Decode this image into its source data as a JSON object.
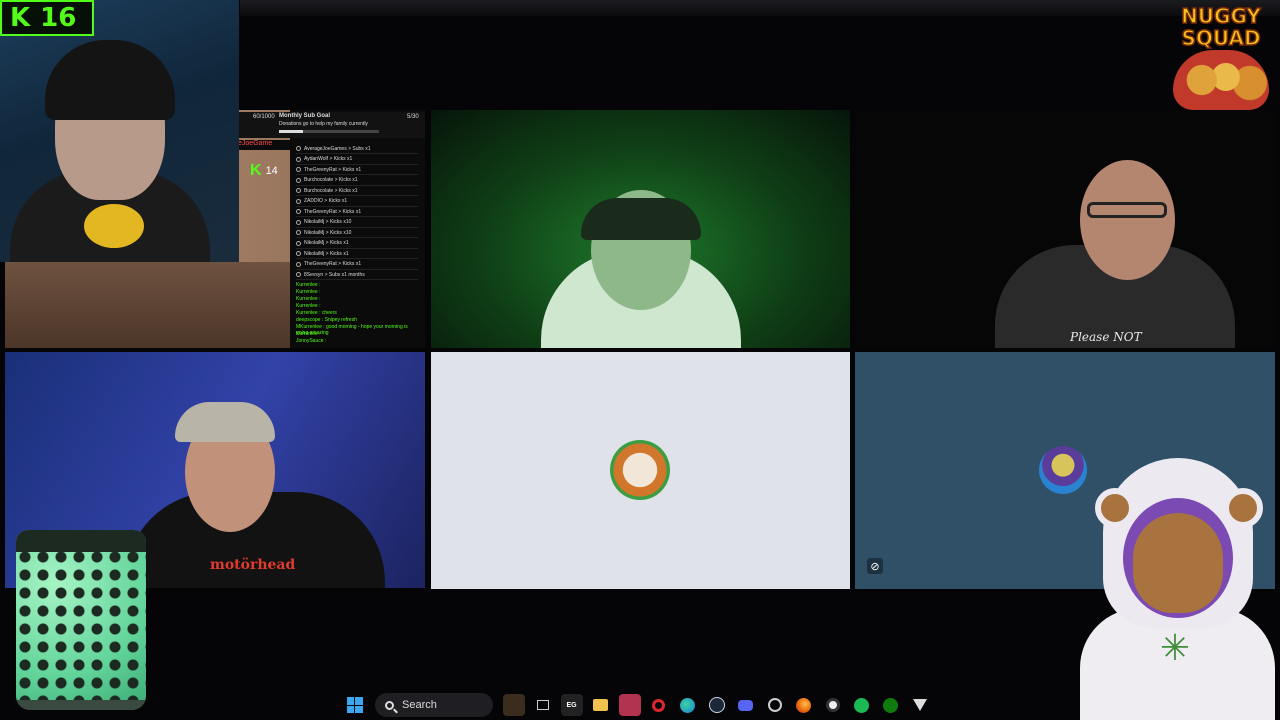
{
  "overlay": {
    "kick_viewers": "16",
    "kick_letter": "K"
  },
  "participants": [
    {
      "kick_letter": "K",
      "kick_viewers": "14",
      "name_partial": "eJoeGame"
    },
    {},
    {
      "shirt_text": "Please NOT"
    },
    {
      "band_shirt_text": "motörhead"
    },
    {},
    {}
  ],
  "sub_goal": {
    "title": "Monthly Sub Goal",
    "subtitle": "Donations go to help my family currently",
    "count": "60/1000",
    "right_count": "5/30"
  },
  "events": [
    "AverageJoeGames > Subs x1",
    "AydanWolf > Kicks x1",
    "TheGreenyRat > Kicks x1",
    "Burchocolate > Kicks x1",
    "Burchocolate > Kicks x1",
    "ZADDIO > Kicks x1",
    "TheGreenyRat > Kicks x1",
    "NikolaiMj > Kicks x10",
    "NikolaiMj > Kicks x10",
    "NikolaiMj > Kicks x1",
    "NikolaiMj > Kicks x1",
    "TheGreenyRat > Kicks x1",
    "8Sevsyn > Subs x1 months"
  ],
  "chat_messages": [
    "Kurrenlee :",
    "Kurrenlee :",
    "Kurrenlee :",
    "Kurrenlee :",
    "Kurrenlee : cheers",
    "deepscope : Snipey refresh",
    "MKurrenlee : good morning - hope your morning is going amazing",
    "Kurrenlee :",
    "JonnySauce :"
  ],
  "logo": {
    "line1": "NUGGY",
    "line2": "SQUAD"
  },
  "taskbar": {
    "search_label": "Search",
    "icons": [
      "windows-start-icon",
      "search-icon",
      "widgets-icon",
      "task-view-icon",
      "epic-games-icon",
      "file-explorer-icon",
      "app-icon",
      "opera-icon",
      "edge-icon",
      "steam-icon",
      "discord-icon",
      "chrome-icon",
      "firefox-icon",
      "obs-icon",
      "spotify-icon",
      "xbox-icon",
      "vpn-icon"
    ]
  },
  "colors": {
    "kick_green": "#53fc18",
    "tile_light": "#dfe2e8",
    "tile_blue": "#2f5066"
  }
}
